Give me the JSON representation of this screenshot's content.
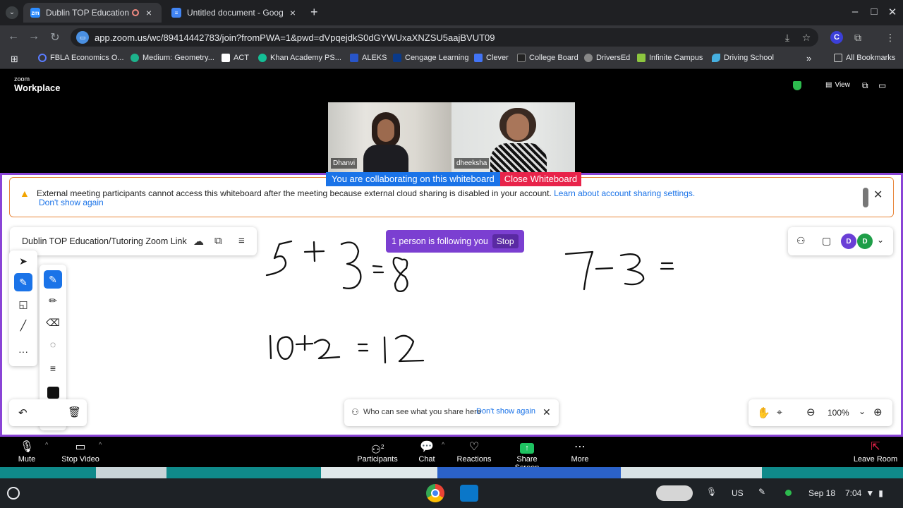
{
  "browser": {
    "tabs": [
      {
        "title": "Dublin TOP Education/Tutor",
        "favicon": "zoom-icon",
        "active": true
      },
      {
        "title": "Untitled document - Google Do",
        "favicon": "docs-icon",
        "active": false
      }
    ],
    "new_tab": "+",
    "url": "app.zoom.us/wc/89414442783/join?fromPWA=1&pwd=dVpqejdkS0dGYWUxaXNZSU5aajBVUT09",
    "bookmarks": [
      "FBLA Economics O...",
      "Medium: Geometry...",
      "ACT",
      "Khan Academy PS...",
      "ALEKS",
      "Cengage Learning",
      "Clever",
      "College Board",
      "DriversEd",
      "Infinite Campus",
      "Driving School"
    ],
    "all_bookmarks": "All Bookmarks",
    "profile_initial": "C"
  },
  "zoom": {
    "logo_top": "zoom",
    "logo_bottom": "Workplace",
    "view_label": "View",
    "participants": [
      {
        "name": "Dhanvi"
      },
      {
        "name": "dheeksha"
      }
    ],
    "collab_text": "You are collaborating on this whiteboard",
    "close_whiteboard": "Close Whiteboard",
    "banner": {
      "message": "External meeting participants cannot access this whiteboard after the meeting because external cloud sharing is disabled in your account.",
      "link": "Learn about account sharing settings.",
      "dont_show": "Don't show again"
    },
    "whiteboard_title": "Dublin TOP Education/Tutoring Zoom Link",
    "following_text": "1 person is following you",
    "stop_label": "Stop",
    "avatars": [
      {
        "initial": "D",
        "color": "#6a3fd6"
      },
      {
        "initial": "D",
        "color": "#1e9e48"
      }
    ],
    "share_hint": "Who can see what you share here",
    "share_hint_dont": "Don't show again",
    "zoom_level": "100%",
    "handwriting": [
      "5 + 3 = 8",
      "7 - 3 =",
      "10 + 2 = 12"
    ],
    "controls": {
      "mute": "Mute",
      "stop_video": "Stop Video",
      "participants": "Participants",
      "participants_count": "2",
      "chat": "Chat",
      "reactions": "Reactions",
      "share_screen": "Share Screen",
      "more": "More",
      "leave_room": "Leave Room"
    }
  },
  "shelf": {
    "locale": "US",
    "date": "Sep 18",
    "time": "7:04"
  }
}
